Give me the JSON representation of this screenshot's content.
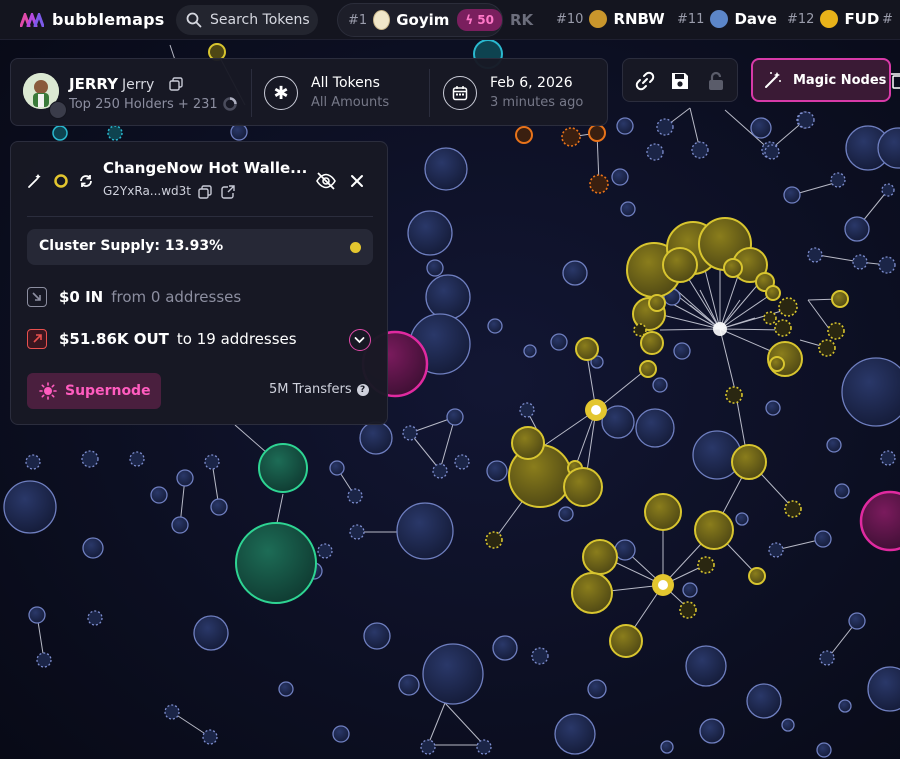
{
  "app": {
    "name": "bubblemaps"
  },
  "search": {
    "label": "Search Tokens"
  },
  "trending": {
    "active": {
      "rank": "#1",
      "name": "Goyim",
      "boost": "50"
    },
    "partial": "RK",
    "items": [
      {
        "rank": "#10",
        "name": "RNBW",
        "color": "#c9962c"
      },
      {
        "rank": "#11",
        "name": "Dave",
        "color": "#5c86c9"
      },
      {
        "rank": "#12",
        "name": "FUD",
        "color": "#e8b21a"
      }
    ],
    "overflow_rank": "#"
  },
  "header": {
    "wallet_name": "JERRY",
    "wallet_alias": "Jerry",
    "holders": "Top 250 Holders + 231",
    "filter_title": "All Tokens",
    "filter_sub": "All Amounts",
    "date_title": "Feb 6, 2026",
    "date_sub": "3 minutes ago"
  },
  "magic_nodes": {
    "label": "Magic Nodes"
  },
  "panel": {
    "title": "ChangeNow Hot Walle...",
    "address": "G2YxRa...wd3t",
    "cluster_label": "Cluster Supply: 13.93%",
    "in_amount": "$0 IN",
    "in_desc": "from 0 addresses",
    "out_amount": "$51.86K OUT",
    "out_desc": "to 19 addresses",
    "supernode_label": "Supernode",
    "transfers": "5M Transfers"
  },
  "colors": {
    "background": "#0b0d1c",
    "bubble_default": "#1b2547",
    "bubble_yellow": "#d4c02e",
    "bubble_green": "#2ed493",
    "bubble_magenta": "#e02aa0",
    "bubble_orange": "#e8731a",
    "accent_pink": "#e04aa9"
  }
}
